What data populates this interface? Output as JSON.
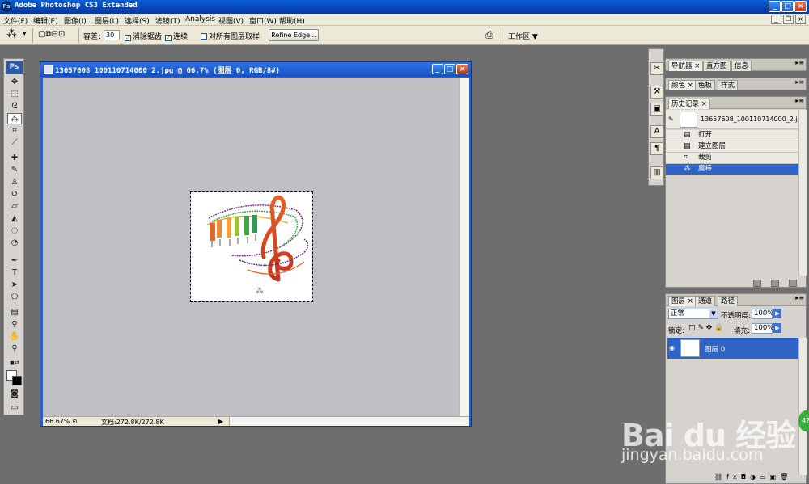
{
  "window": {
    "title": "Adobe Photoshop CS3 Extended",
    "logo": "Ps"
  },
  "menu": [
    "文件(F)",
    "编辑(E)",
    "图像(I)",
    "图层(L)",
    "选择(S)",
    "滤镜(T)",
    "Analysis",
    "视图(V)",
    "窗口(W)",
    "帮助(H)"
  ],
  "options": {
    "tolerance_label": "容差:",
    "tolerance_value": "30",
    "antialias_label": "消除锯齿",
    "contiguous_label": "连续",
    "sample_all_label": "对所有图层取样",
    "refine_edge": "Refine Edge...",
    "workspace": "工作区 ▼"
  },
  "toolbox": {
    "logo": "Ps"
  },
  "document": {
    "title": "13657608_100110714000_2.jpg @ 66.7% (图层 0, RGB/8#)",
    "zoom": "66.67%",
    "doc_info": "文档:272.8K/272.8K"
  },
  "panels": {
    "nav_tabs": [
      "导航器",
      "直方图",
      "信息"
    ],
    "color_tabs": [
      "颜色",
      "色板",
      "样式"
    ],
    "history_tab": "历史记录",
    "history_snapshot": "13657608_100110714000_2.jpg",
    "history_items": [
      "打开",
      "建立图层",
      "裁剪",
      "魔棒"
    ],
    "layers_tabs": [
      "图层",
      "通道",
      "路径"
    ],
    "blend_mode": "正常",
    "opacity_label": "不透明度:",
    "opacity_value": "100%",
    "lock_label": "锁定:",
    "fill_label": "填充:",
    "fill_value": "100%",
    "layer_name": "图层 0"
  },
  "watermark": {
    "brand": "Bai du 经验",
    "url": "jingyan.baidu.com",
    "badge": "47"
  }
}
